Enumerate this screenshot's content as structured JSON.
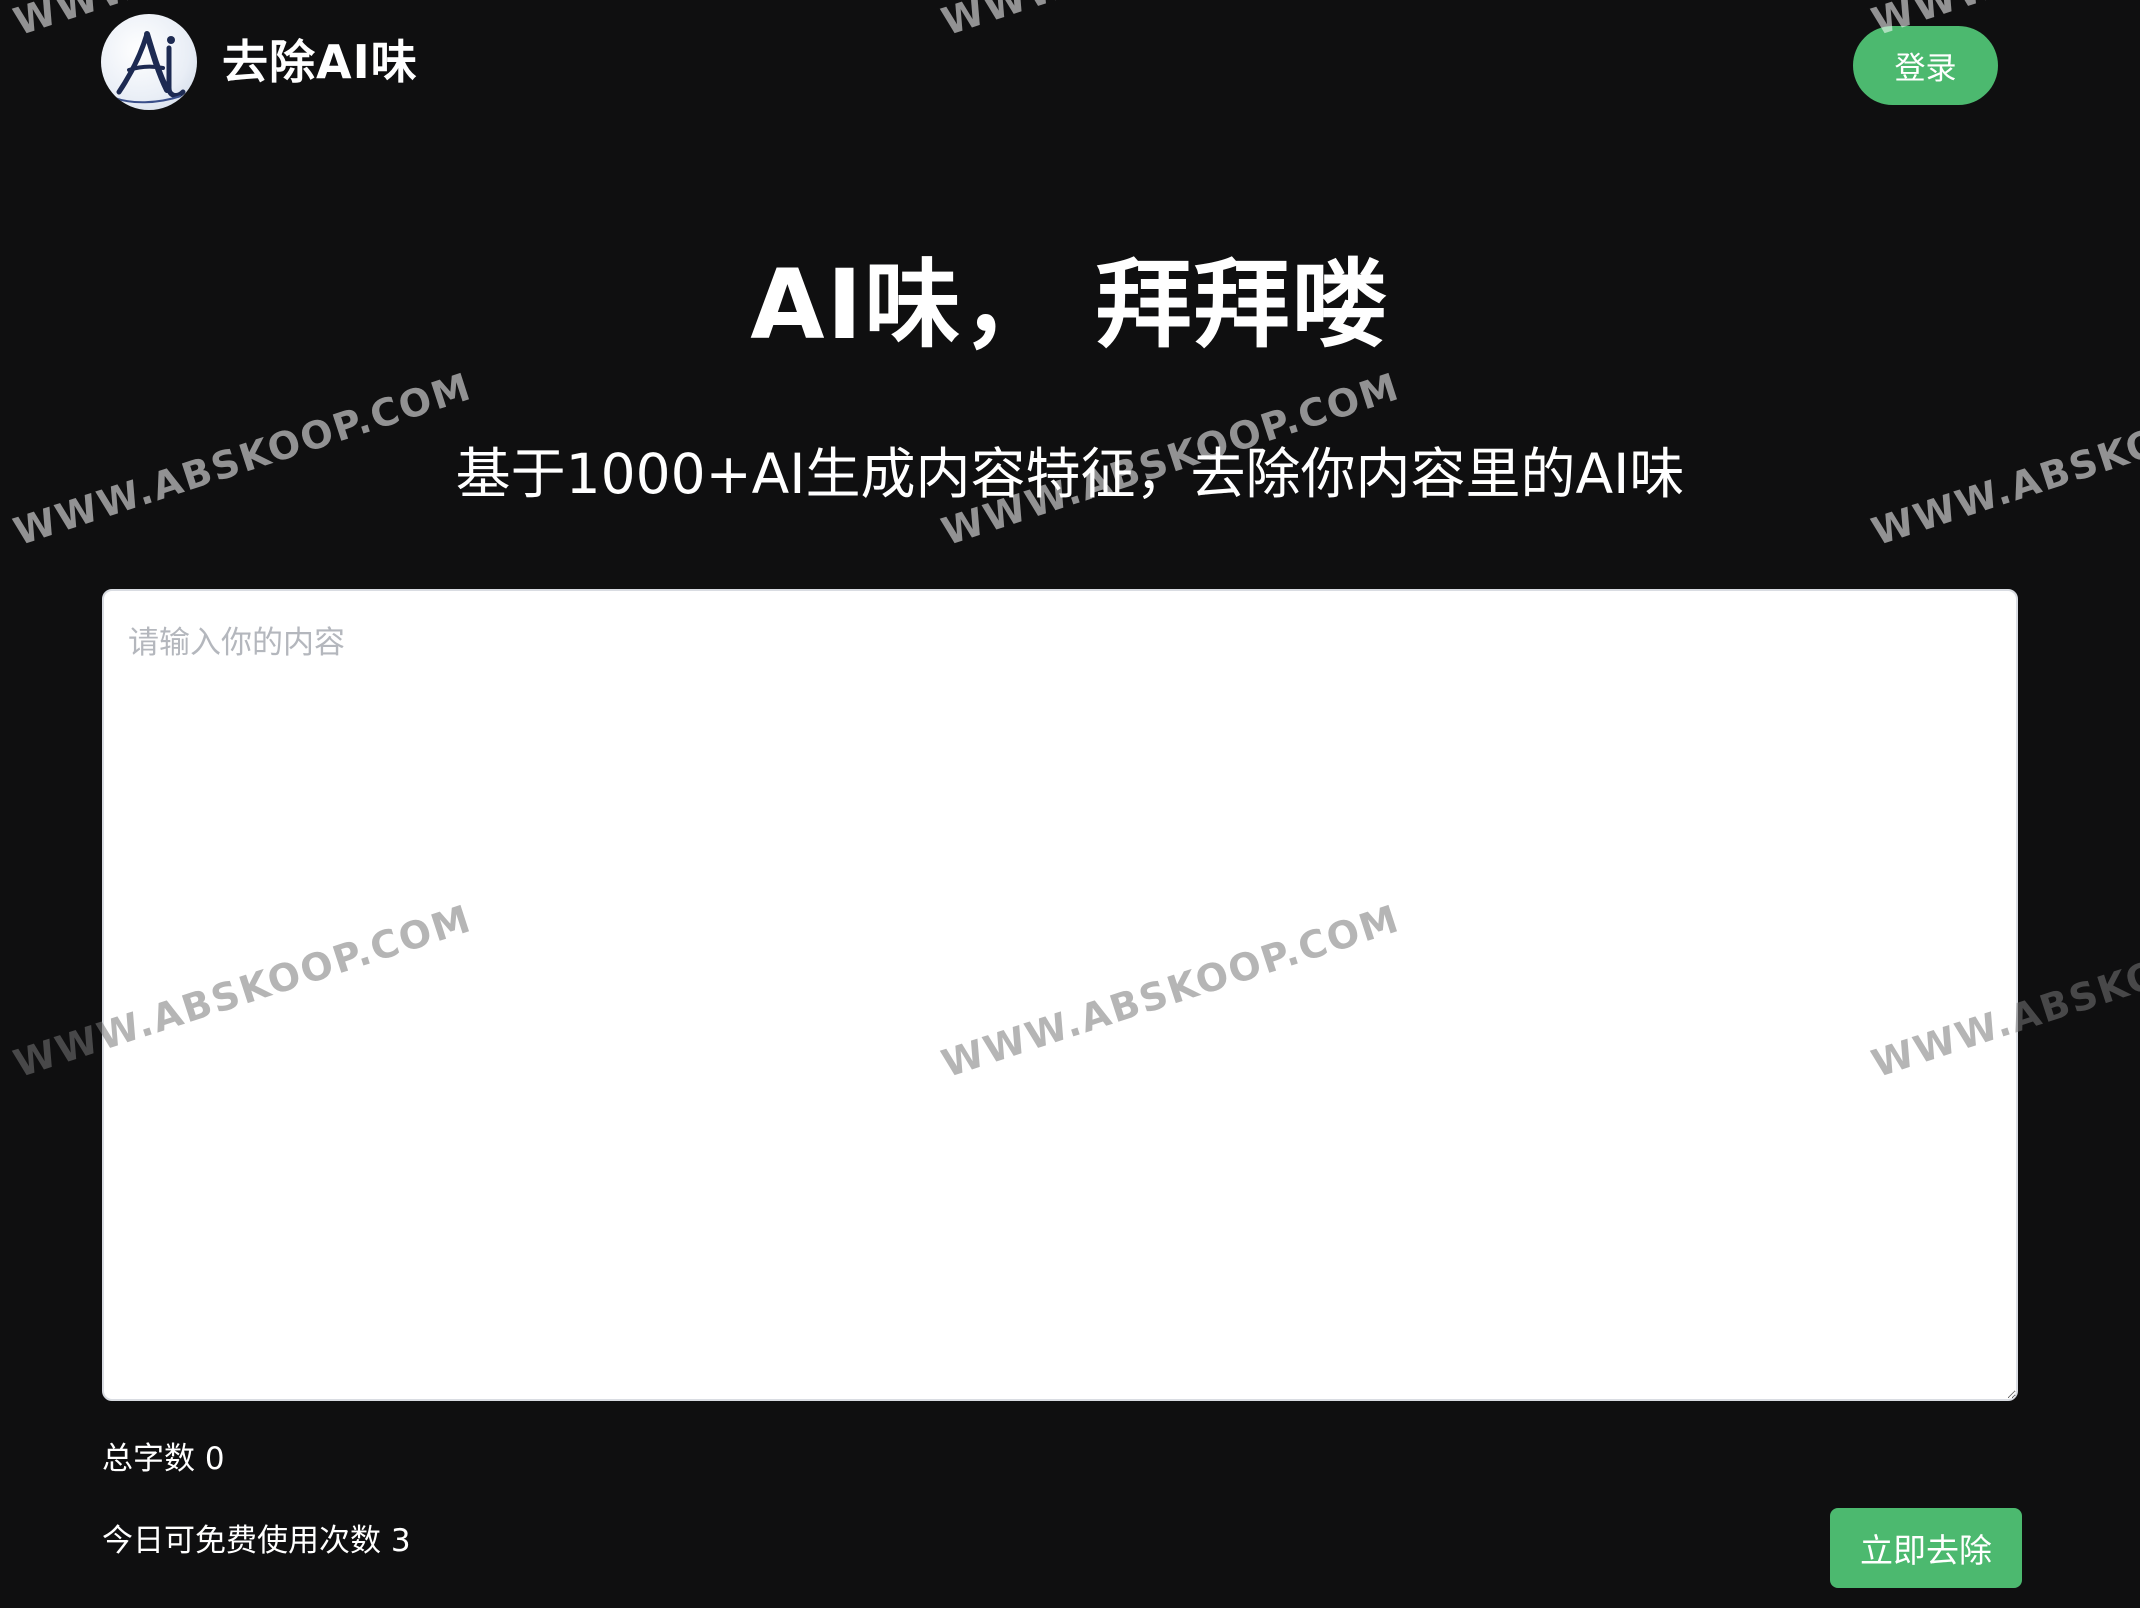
{
  "header": {
    "logo_text": "AI",
    "brand": "去除AI味",
    "login_label": "登录"
  },
  "hero": {
    "title": "AI味， 拜拜喽",
    "subtitle": "基于1000+AI生成内容特征，去除你内容里的AI味"
  },
  "editor": {
    "placeholder": "请输入你的内容",
    "value": ""
  },
  "stats": {
    "word_count_label": "总字数",
    "word_count": "0",
    "free_uses_label": "今日可免费使用次数",
    "free_uses": "3"
  },
  "actions": {
    "submit_label": "立即去除"
  },
  "watermark": "WWW.ABSKOOP.COM",
  "colors": {
    "background": "#0f0f10",
    "accent": "#4cb96f",
    "text": "#ffffff"
  }
}
